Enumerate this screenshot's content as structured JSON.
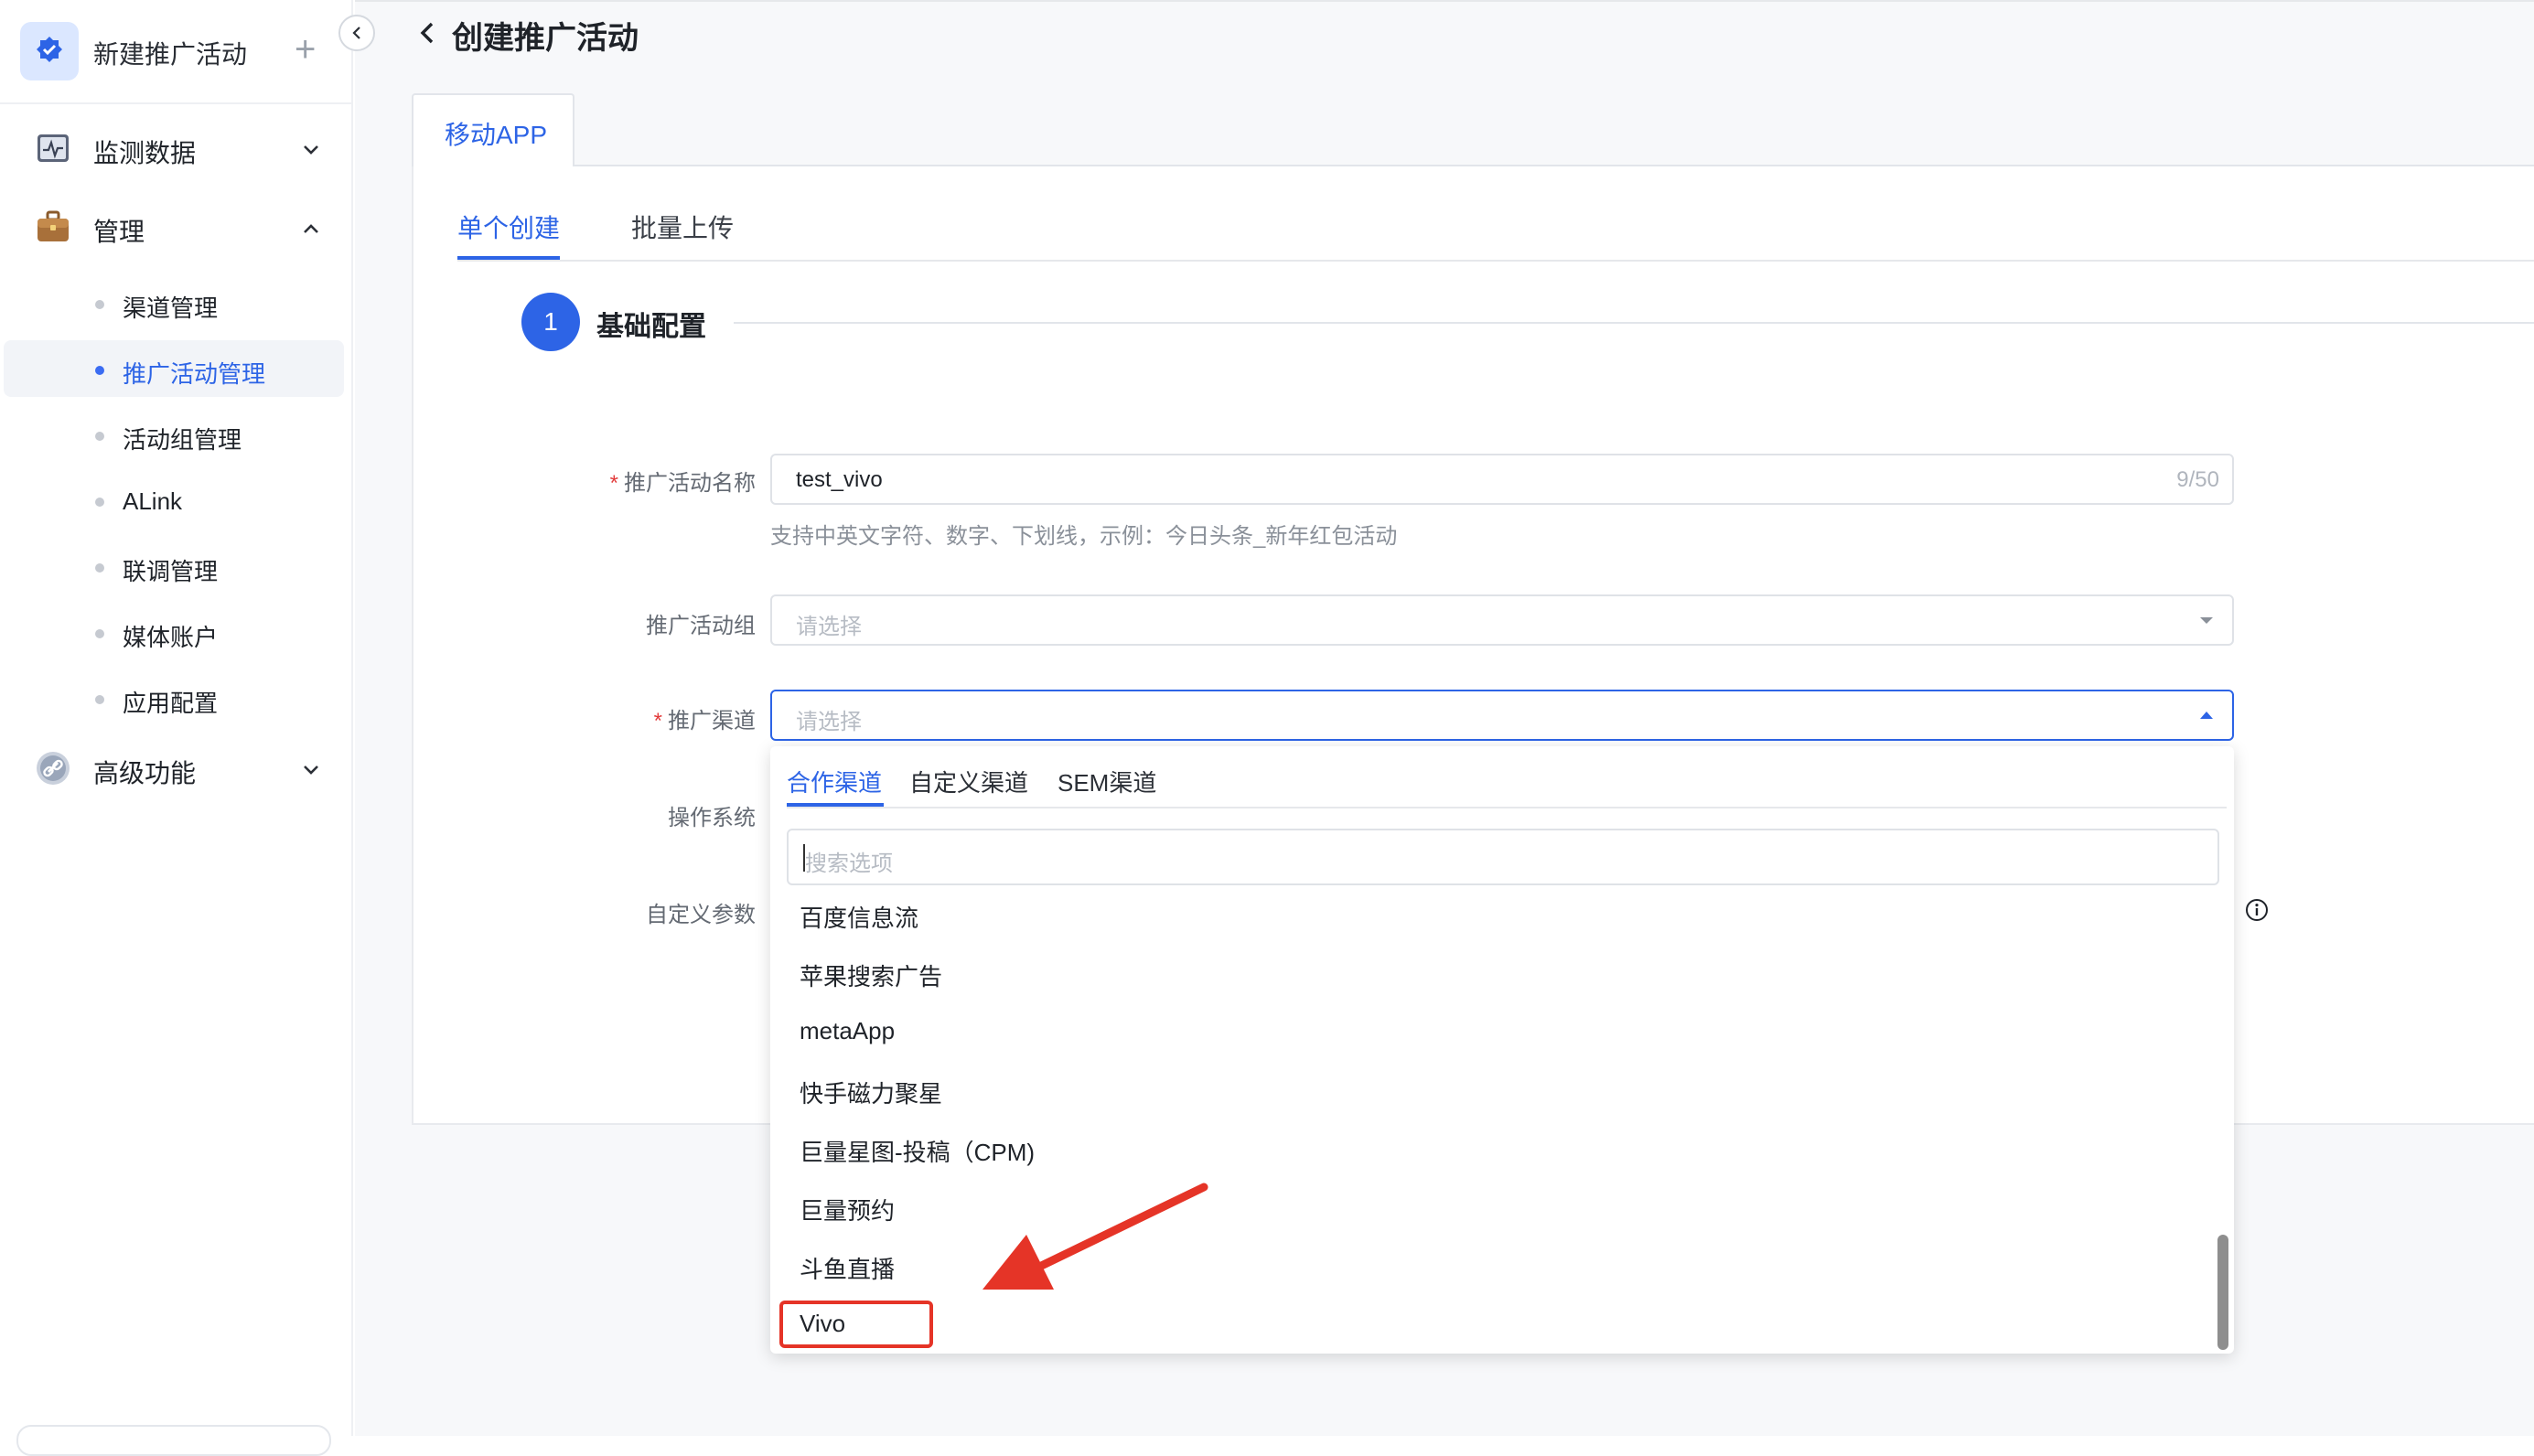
{
  "colors": {
    "primary": "#2d64e6",
    "required": "#e23b3b",
    "annotation": "#e53427"
  },
  "sidebar": {
    "new_activity_label": "新建推广活动",
    "new_activity_icon": "badge-check-icon",
    "plus_icon": "plus-icon",
    "groups": [
      {
        "label": "监测数据",
        "icon": "chart-monitor-icon",
        "expanded": false
      },
      {
        "label": "管理",
        "icon": "briefcase-icon",
        "expanded": true
      },
      {
        "label": "高级功能",
        "icon": "link-icon",
        "expanded": false
      }
    ],
    "items": [
      {
        "label": "渠道管理",
        "active": false
      },
      {
        "label": "推广活动管理",
        "active": true
      },
      {
        "label": "活动组管理",
        "active": false
      },
      {
        "label": "ALink",
        "active": false
      },
      {
        "label": "联调管理",
        "active": false
      },
      {
        "label": "媒体账户",
        "active": false
      },
      {
        "label": "应用配置",
        "active": false
      }
    ]
  },
  "header": {
    "title": "创建推广活动"
  },
  "platform_tab": "移动APP",
  "sub_tabs": [
    "单个创建",
    "批量上传"
  ],
  "step": {
    "number": "1",
    "title": "基础配置"
  },
  "form": {
    "name": {
      "label": "推广活动名称",
      "required": true,
      "value": "test_vivo",
      "counter": "9/50",
      "hint": "支持中英文字符、数字、下划线，示例：今日头条_新年红包活动"
    },
    "group": {
      "label": "推广活动组",
      "placeholder": "请选择"
    },
    "channel": {
      "label": "推广渠道",
      "required": true,
      "placeholder": "请选择"
    },
    "os": {
      "label": "操作系统"
    },
    "custom_params": {
      "label": "自定义参数"
    },
    "required_mark": "*"
  },
  "dropdown": {
    "tabs": [
      "合作渠道",
      "自定义渠道",
      "SEM渠道"
    ],
    "search_placeholder": "搜索选项",
    "options": [
      "百度信息流",
      "苹果搜索广告",
      "metaApp",
      "快手磁力聚星",
      "巨量星图-投稿（CPM)",
      "巨量预约",
      "斗鱼直播",
      "Vivo"
    ],
    "highlighted": "Vivo"
  }
}
